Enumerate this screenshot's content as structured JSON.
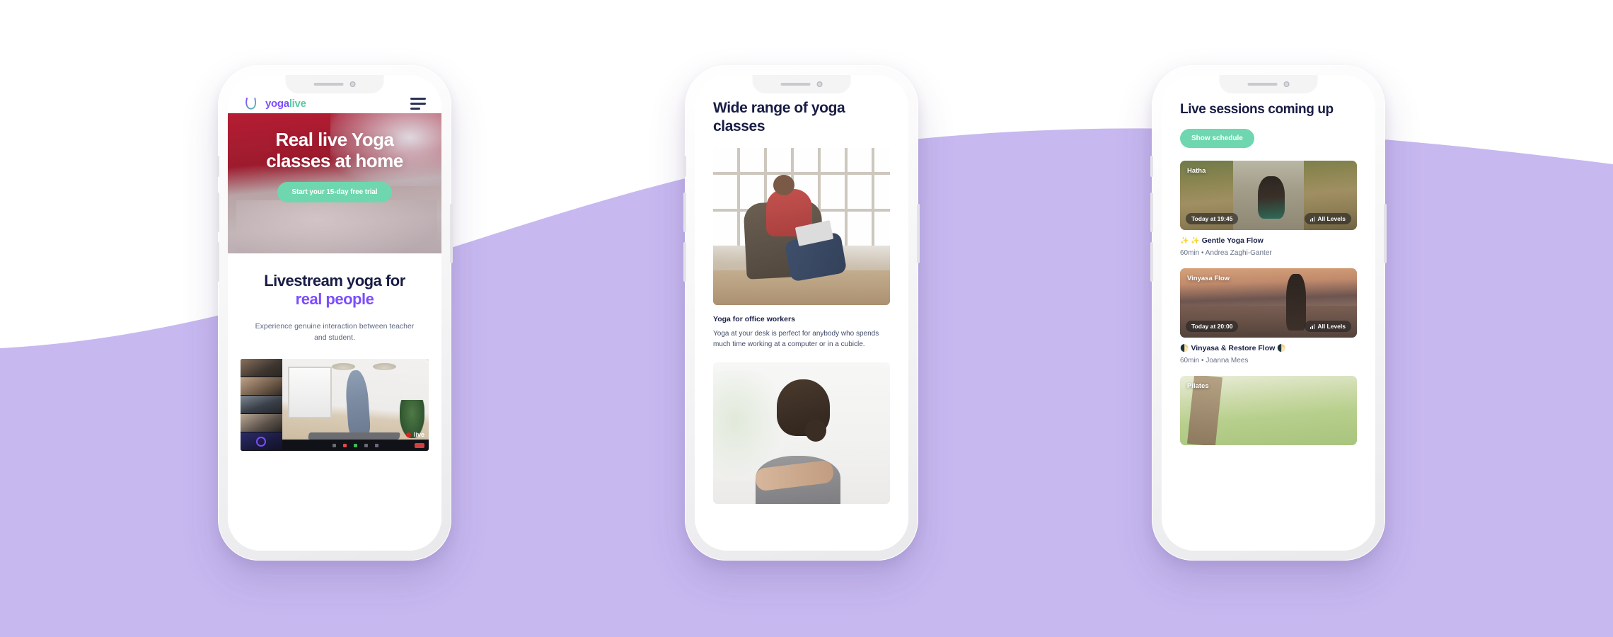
{
  "background": {
    "base_color": "#FFFFFF",
    "wave_color": "#C7B8F0"
  },
  "phone1": {
    "header": {
      "logo_mark": "yogalive-logo-mark",
      "logo_text_primary": "yoga",
      "logo_text_secondary": "live",
      "menu_icon": "hamburger-menu-icon"
    },
    "hero": {
      "title": "Real live Yoga classes at home",
      "cta_label": "Start your 15-day free trial",
      "cta_color": "#6FD7AF"
    },
    "section": {
      "title_line1": "Livestream yoga for",
      "title_line2": "real people",
      "accent_color": "#7C4DFF",
      "subtitle": "Experience genuine interaction between teacher and student."
    },
    "video_call": {
      "live_label": "live"
    }
  },
  "phone2": {
    "title": "Wide range of yoga classes",
    "cards": [
      {
        "image_name": "woman-working-on-laptop-in-chair",
        "caption_title": "Yoga for office workers",
        "caption_body": "Yoga at your desk is perfect for anybody who spends much time working at a computer or in a cubicle."
      },
      {
        "image_name": "woman-stretching-arm"
      }
    ]
  },
  "phone3": {
    "title": "Live sessions coming up",
    "button_label": "Show schedule",
    "button_color": "#6FD7AF",
    "sessions": [
      {
        "category": "Hatha",
        "time": "Today at 19:45",
        "level": "All Levels",
        "name_prefix": "✨ ✨",
        "name": "Gentle Yoga Flow",
        "name_suffix": "",
        "duration": "60min",
        "separator": "•",
        "instructor": "Andrea Zaghi-Ganter",
        "image_name": "woman-meditating-on-path"
      },
      {
        "category": "Vinyasa Flow",
        "time": "Today at 20:00",
        "level": "All Levels",
        "name_prefix": "🌓",
        "name": "Vinyasa & Restore Flow",
        "name_suffix": "🌓",
        "duration": "60min",
        "separator": "•",
        "instructor": "Joanna Mees",
        "image_name": "woman-tree-pose-at-lake-sunset"
      },
      {
        "category": "Pilates",
        "image_name": "green-forest-branches"
      }
    ]
  }
}
